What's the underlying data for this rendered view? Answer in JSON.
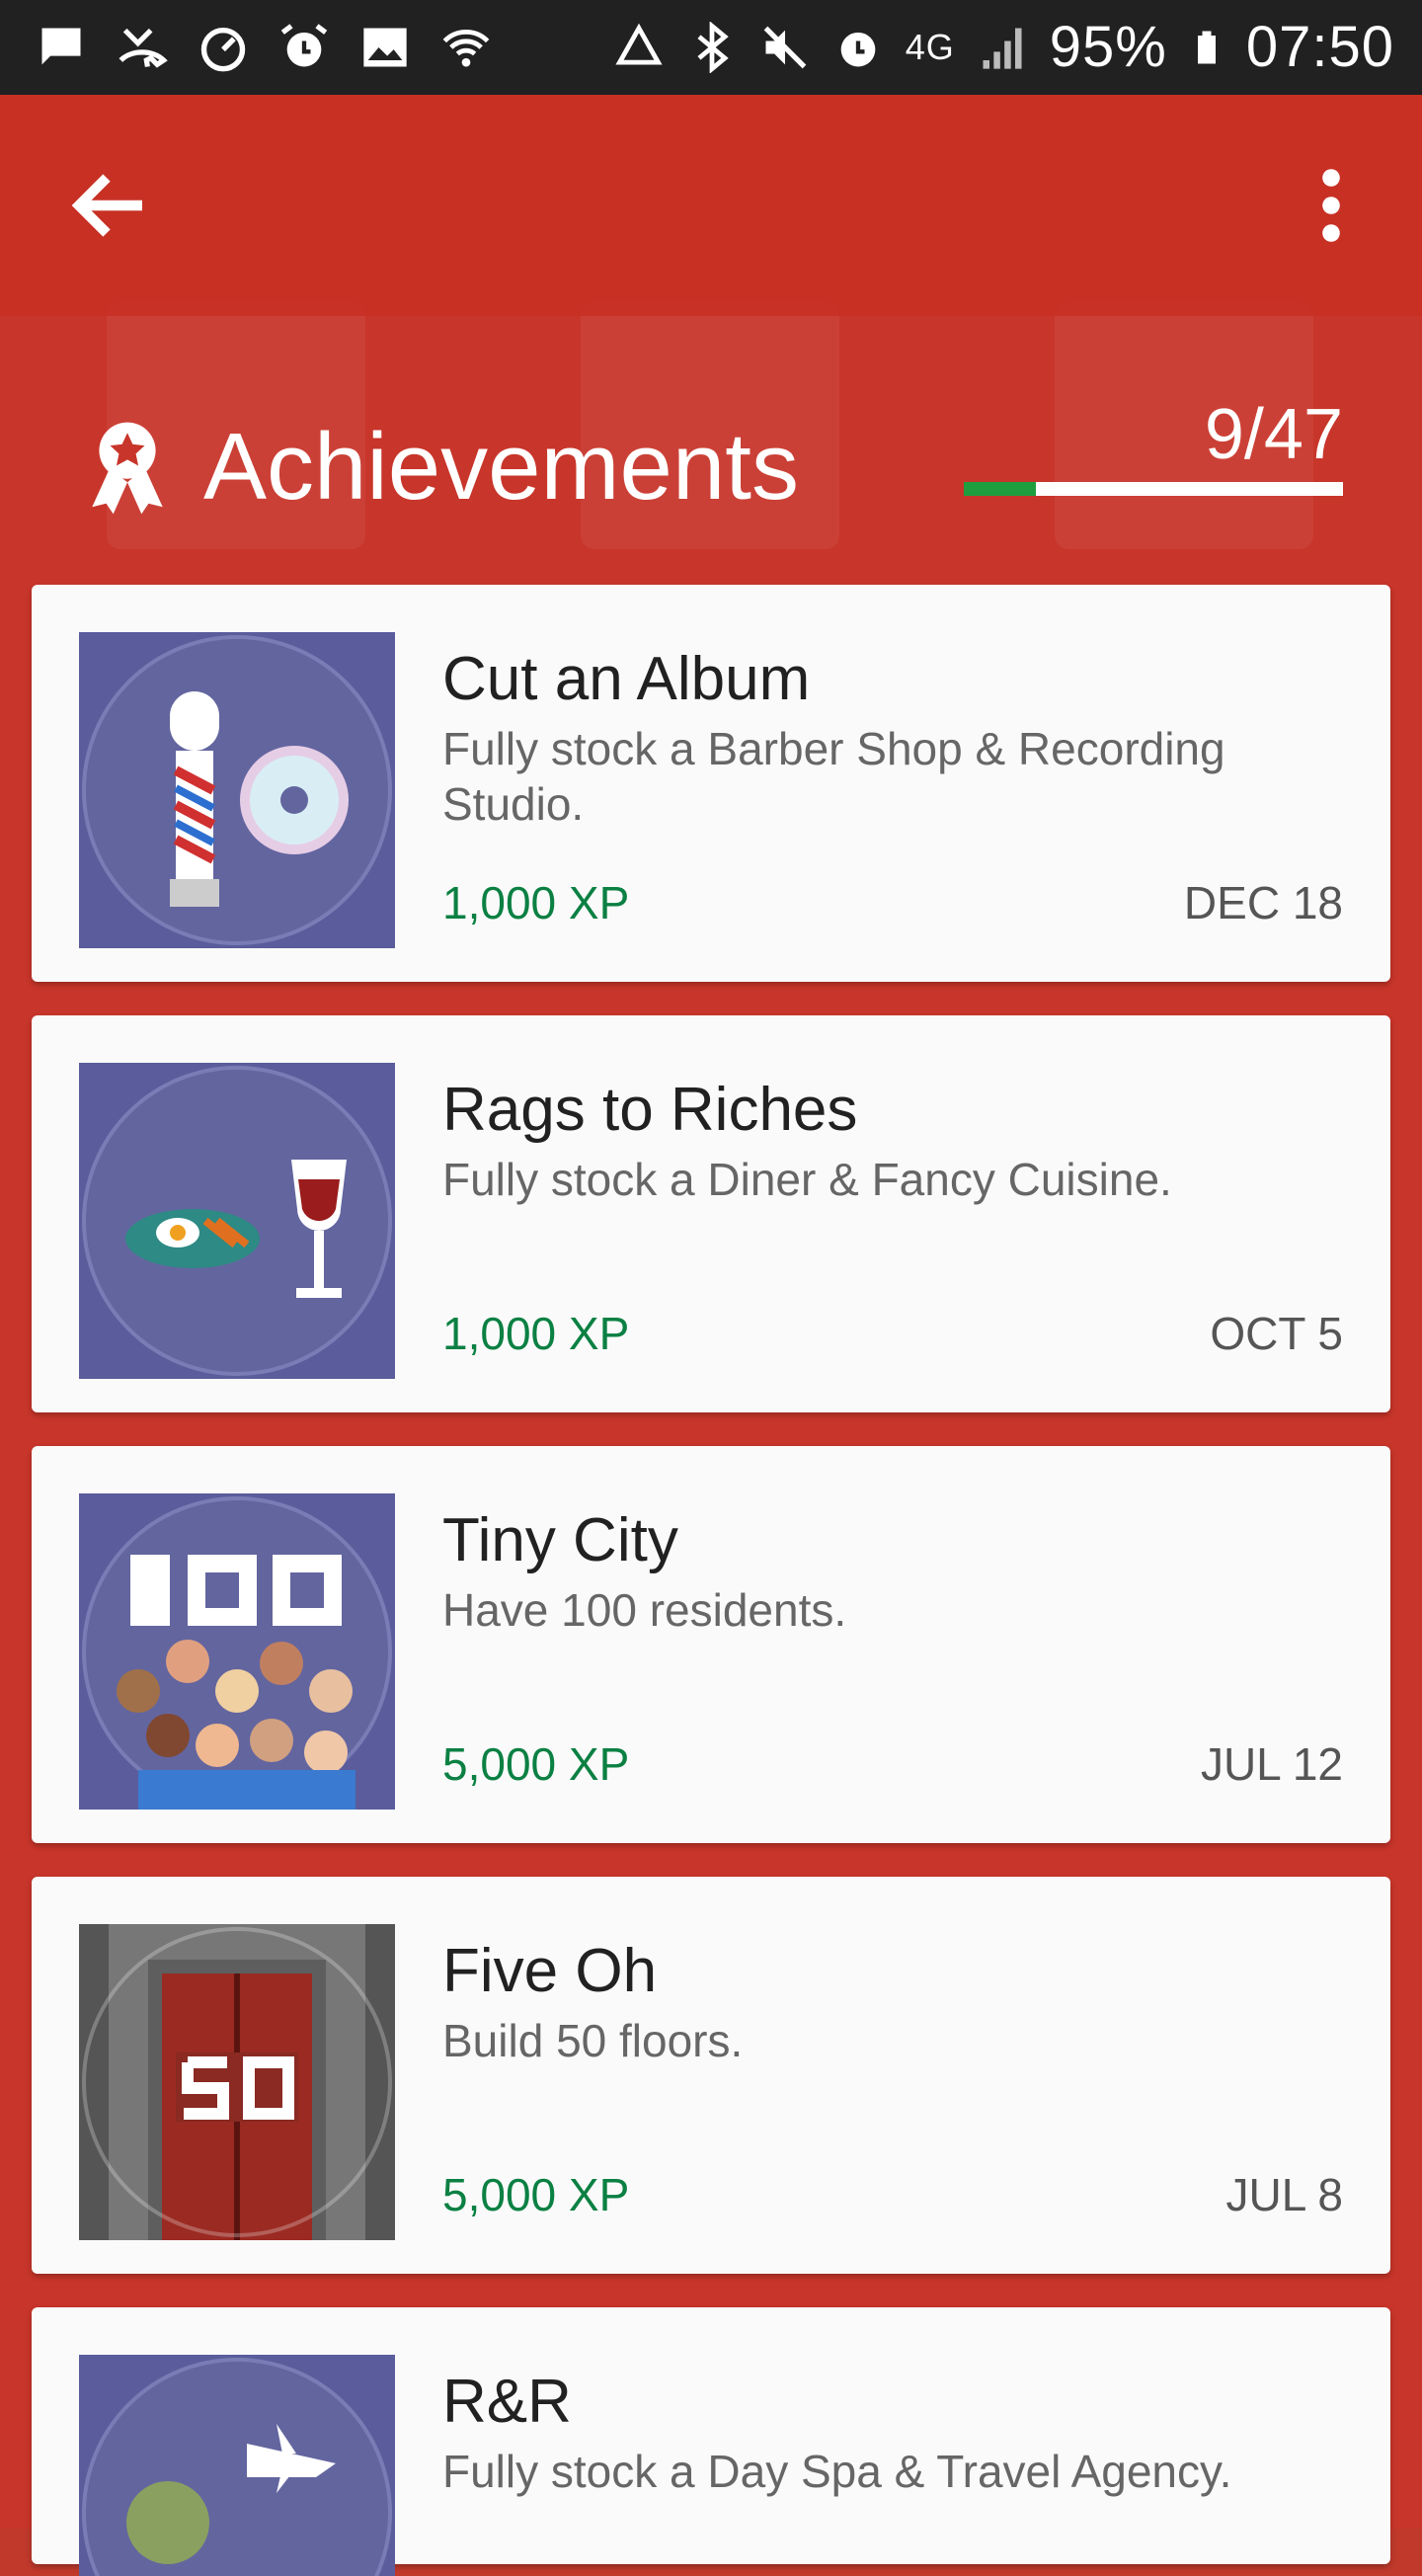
{
  "status_bar": {
    "battery": "95%",
    "time": "07:50",
    "network": "4G"
  },
  "toolbar": {
    "back_icon": "arrow-left-icon",
    "menu_icon": "more-vert-icon"
  },
  "header": {
    "title": "Achievements",
    "progress_text": "9/47",
    "progress_fraction": 0.19,
    "icon": "award-ribbon-icon"
  },
  "achievements": [
    {
      "title": "Cut an Album",
      "description": "Fully stock a Barber Shop & Recording Studio.",
      "xp": "1,000 XP",
      "date": "DEC 18",
      "image": "barber-pole-and-cd"
    },
    {
      "title": "Rags to Riches",
      "description": "Fully stock a Diner & Fancy Cuisine.",
      "xp": "1,000 XP",
      "date": "OCT 5",
      "image": "diner-plate-and-wine"
    },
    {
      "title": "Tiny City",
      "description": "Have 100 residents.",
      "xp": "5,000 XP",
      "date": "JUL 12",
      "image": "100-residents"
    },
    {
      "title": "Five Oh",
      "description": "Build 50 floors.",
      "xp": "5,000 XP",
      "date": "JUL 8",
      "image": "elevator-50"
    },
    {
      "title": "R&R",
      "description": "Fully stock a Day Spa & Travel Agency.",
      "xp": "",
      "date": "",
      "image": "spa-and-airplane"
    }
  ],
  "colors": {
    "toolbar": "#c8352a",
    "xp_green": "#0b8043",
    "progress_green": "#1e9e3e",
    "badge_bg": "#5a5c9c"
  }
}
